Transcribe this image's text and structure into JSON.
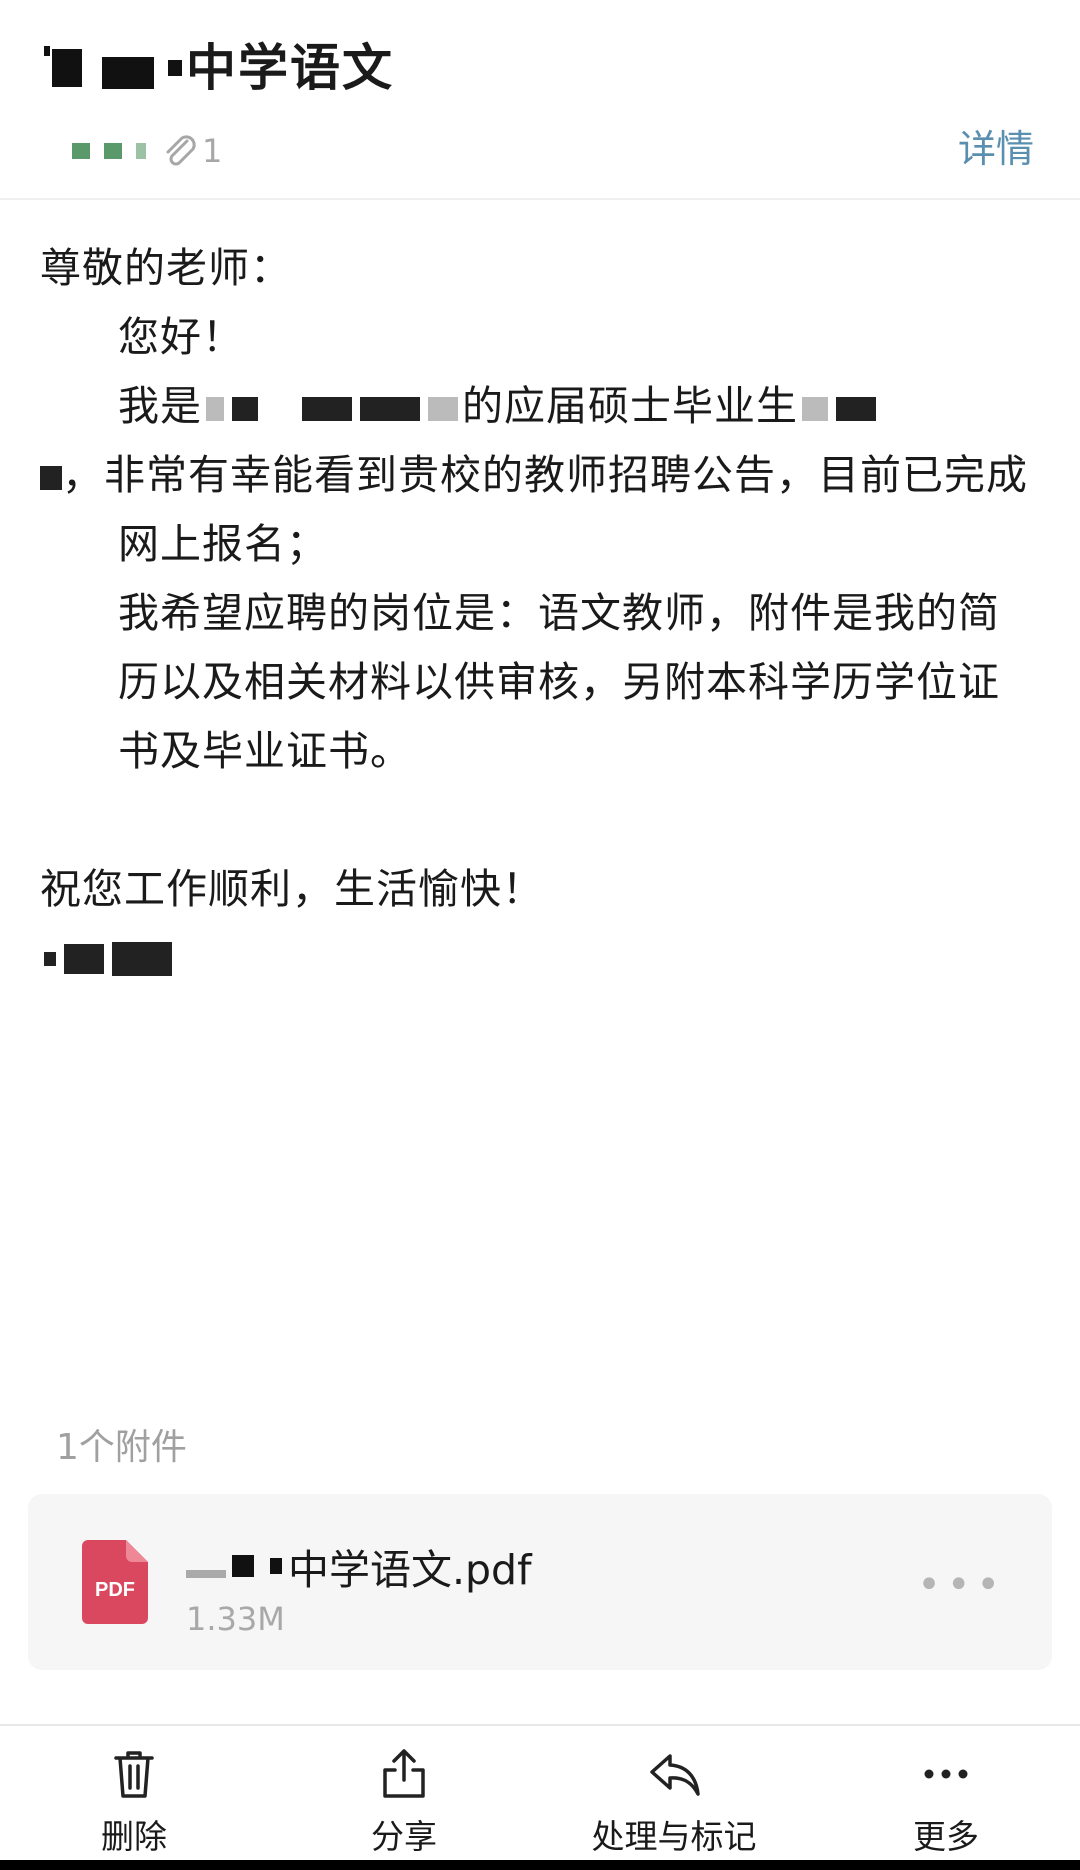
{
  "header": {
    "subject": "中学语文",
    "attachment_count_badge": "1",
    "details_label": "详情"
  },
  "body": {
    "greeting": "尊敬的老师：",
    "hello": "您好！",
    "para1_start": "我是",
    "para1_mid": "的应届硕士毕业生",
    "para1_rest": "，非常有幸能看到贵校的教师招聘公告，目前已完成网上报名；",
    "para2": "我希望应聘的岗位是：语文教师，附件是我的简历以及相关材料以供审核，另附本科学历学位证书及毕业证书。",
    "closing": "祝您工作顺利，生活愉快！"
  },
  "attachments": {
    "count_label": "1个附件",
    "items": [
      {
        "name": "中学语文.pdf",
        "size": "1.33M",
        "type_label": "PDF"
      }
    ]
  },
  "bottom_bar": {
    "items": [
      {
        "label": "删除",
        "icon": "trash-icon"
      },
      {
        "label": "分享",
        "icon": "share-icon"
      },
      {
        "label": "处理与标记",
        "icon": "reply-icon"
      },
      {
        "label": "更多",
        "icon": "more-icon"
      }
    ]
  },
  "colors": {
    "accent": "#5b8fb0",
    "pdf": "#d9485f",
    "muted": "#a0a0a0"
  }
}
